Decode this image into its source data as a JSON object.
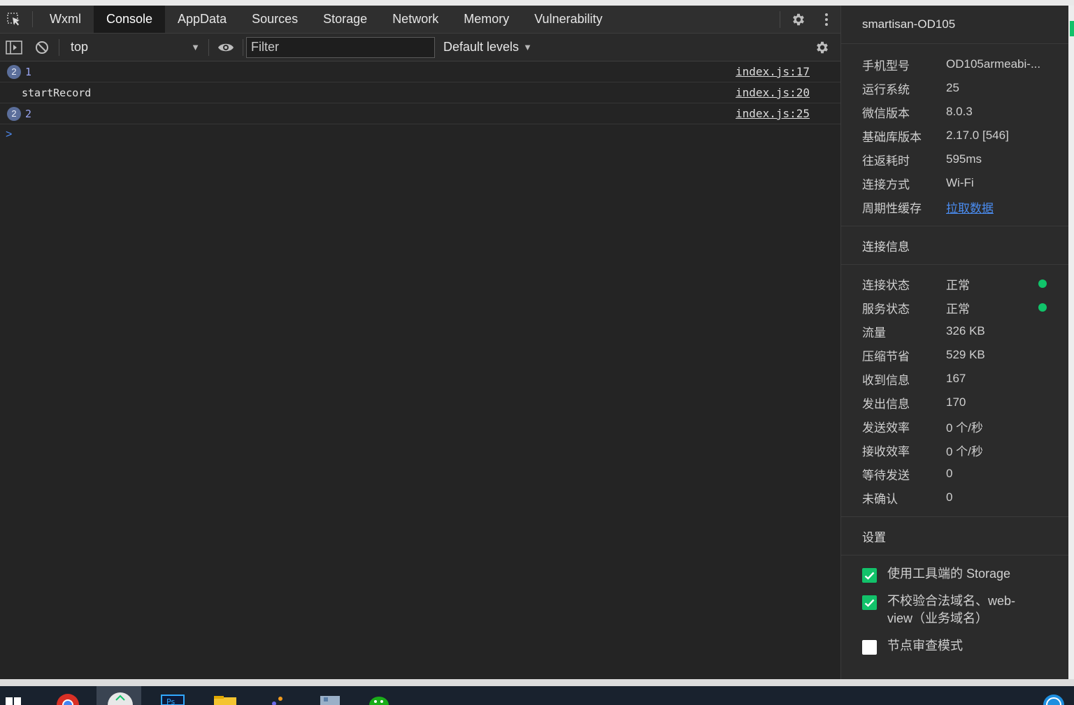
{
  "tabs": [
    "Wxml",
    "Console",
    "AppData",
    "Sources",
    "Storage",
    "Network",
    "Memory",
    "Vulnerability"
  ],
  "active_tab": "Console",
  "toolbar": {
    "context": "top",
    "filter_placeholder": "Filter",
    "levels": "Default levels"
  },
  "console_rows": [
    {
      "badge": "2",
      "text": "1",
      "source": "index.js:17"
    },
    {
      "badge": "",
      "text": "startRecord",
      "source": "index.js:20"
    },
    {
      "badge": "2",
      "text": "2",
      "source": "index.js:25"
    }
  ],
  "prompt": ">",
  "panel": {
    "device": "smartisan-OD105",
    "info": [
      {
        "k": "手机型号",
        "v": "OD105armeabi-..."
      },
      {
        "k": "运行系统",
        "v": "25"
      },
      {
        "k": "微信版本",
        "v": "8.0.3"
      },
      {
        "k": "基础库版本",
        "v": "2.17.0 [546]"
      },
      {
        "k": "往返耗时",
        "v": "595ms"
      },
      {
        "k": "连接方式",
        "v": "Wi-Fi"
      },
      {
        "k": "周期性缓存",
        "v": "拉取数据",
        "link": true
      }
    ],
    "conn_title": "连接信息",
    "conn": [
      {
        "k": "连接状态",
        "v": "正常",
        "status": "ok"
      },
      {
        "k": "服务状态",
        "v": "正常",
        "status": "ok"
      },
      {
        "k": "流量",
        "v": "326 KB"
      },
      {
        "k": "压缩节省",
        "v": "529 KB"
      },
      {
        "k": "收到信息",
        "v": "167"
      },
      {
        "k": "发出信息",
        "v": "170"
      },
      {
        "k": "发送效率",
        "v": "0 个/秒"
      },
      {
        "k": "接收效率",
        "v": "0 个/秒"
      },
      {
        "k": "等待发送",
        "v": "0"
      },
      {
        "k": "未确认",
        "v": "0"
      }
    ],
    "settings_title": "设置",
    "settings": [
      {
        "label": "使用工具端的 Storage",
        "checked": true
      },
      {
        "label": "不校验合法域名、web-view（业务域名）",
        "checked": true
      },
      {
        "label": "节点审查模式",
        "checked": false
      }
    ]
  },
  "colors": {
    "accent_green": "#12c26a",
    "link_blue": "#4a8cf0",
    "badge": "#5b6e9a"
  }
}
